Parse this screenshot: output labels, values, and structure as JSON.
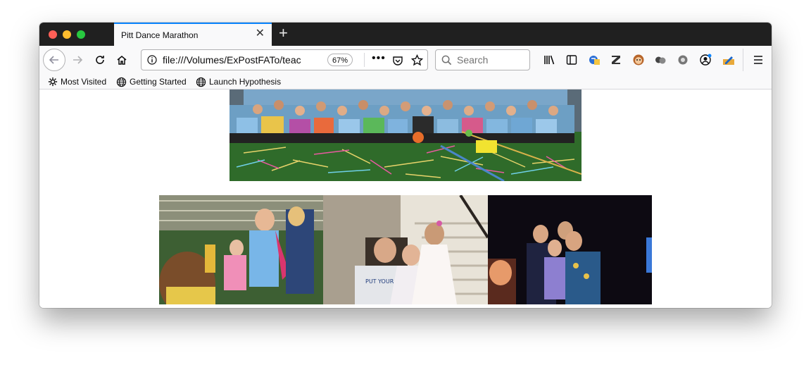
{
  "tab": {
    "title": "Pitt Dance Marathon"
  },
  "toolbar": {
    "url": "file:///Volumes/ExPostFATo/teac",
    "zoom": "67%",
    "search_placeholder": "Search"
  },
  "bookmarks": [
    {
      "label": "Most Visited",
      "icon": "gear-icon"
    },
    {
      "label": "Getting Started",
      "icon": "globe-icon"
    },
    {
      "label": "Launch Hypothesis",
      "icon": "globe-icon"
    }
  ],
  "photos": [
    {
      "name": "group-photo-tie-dye"
    },
    {
      "name": "photo-kids-princess"
    },
    {
      "name": "photo-girls-stairs"
    },
    {
      "name": "photo-dance-floor"
    }
  ],
  "colors": {
    "accent": "#0a84ff",
    "tabbar": "#202020",
    "toolbar": "#f9f9fa"
  }
}
